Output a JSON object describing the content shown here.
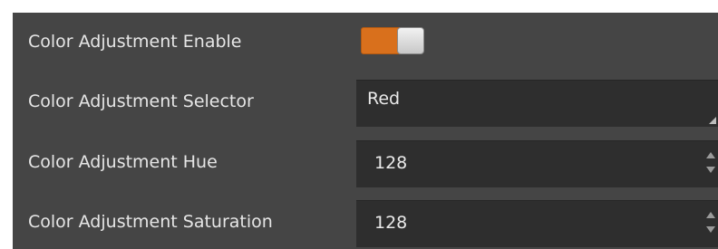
{
  "rows": [
    {
      "label": "Color Adjustment Enable",
      "toggle_on": true
    },
    {
      "label": "Color Adjustment Selector",
      "value": "Red"
    },
    {
      "label": "Color Adjustment Hue",
      "value": "128"
    },
    {
      "label": "Color Adjustment Saturation",
      "value": "128"
    }
  ],
  "colors": {
    "panel_bg": "#454545",
    "field_bg": "#2e2e2e",
    "toggle_accent": "#d9701c",
    "text": "#e6e6e6"
  },
  "icons": {
    "toggle": "toggle-switch-on",
    "dropdown": "dropdown-corner-grip",
    "spin_up": "up-arrow-icon",
    "spin_down": "down-arrow-icon"
  }
}
